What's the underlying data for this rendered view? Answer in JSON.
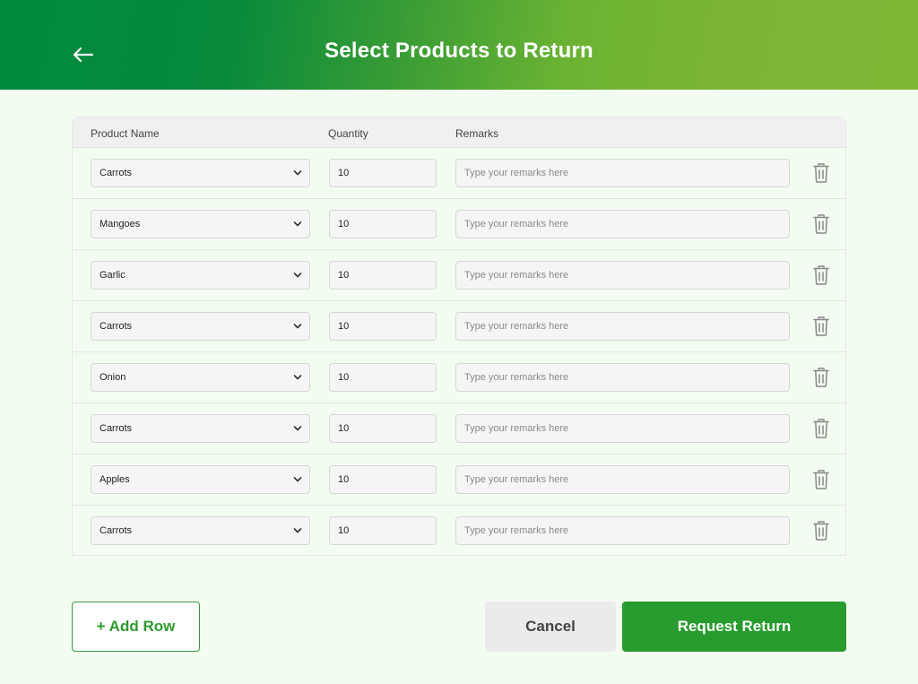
{
  "header": {
    "title": "Select Products to Return"
  },
  "table": {
    "columns": {
      "product": "Product Name",
      "quantity": "Quantity",
      "remarks": "Remarks"
    },
    "remarks_placeholder": "Type your remarks here",
    "rows": [
      {
        "product": "Carrots",
        "quantity": "10"
      },
      {
        "product": "Mangoes",
        "quantity": "10"
      },
      {
        "product": "Garlic",
        "quantity": "10"
      },
      {
        "product": "Carrots",
        "quantity": "10"
      },
      {
        "product": "Onion",
        "quantity": "10"
      },
      {
        "product": "Carrots",
        "quantity": "10"
      },
      {
        "product": "Apples",
        "quantity": "10"
      },
      {
        "product": "Carrots",
        "quantity": "10"
      }
    ]
  },
  "actions": {
    "add_row": "+ Add Row",
    "cancel": "Cancel",
    "request_return": "Request Return"
  },
  "icons": {
    "back": "arrow-left-icon",
    "dropdown": "chevron-down-icon",
    "delete": "trash-icon"
  },
  "colors": {
    "primary_green": "#289b2e",
    "header_dark": "#008a3e",
    "header_light": "#80b735",
    "page_background": "#f3fcf1"
  }
}
